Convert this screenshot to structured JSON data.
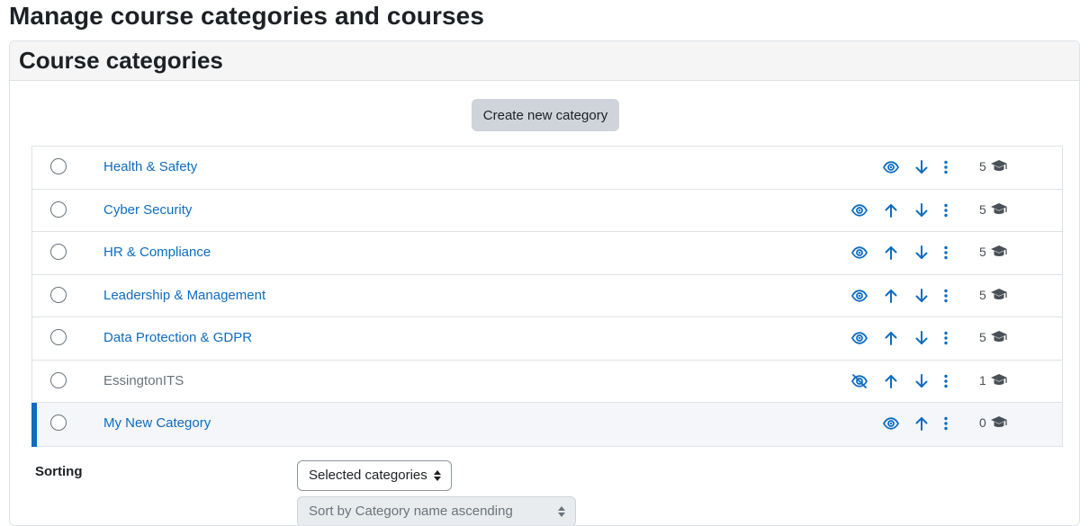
{
  "page": {
    "title": "Manage course categories and courses"
  },
  "card": {
    "header": "Course categories",
    "create_button": "Create new category"
  },
  "categories": [
    {
      "name": "Health & Safety",
      "count": "5",
      "visible": true,
      "up": false,
      "down": true
    },
    {
      "name": "Cyber Security",
      "count": "5",
      "visible": true,
      "up": true,
      "down": true
    },
    {
      "name": "HR & Compliance",
      "count": "5",
      "visible": true,
      "up": true,
      "down": true
    },
    {
      "name": "Leadership & Management",
      "count": "5",
      "visible": true,
      "up": true,
      "down": true
    },
    {
      "name": "Data Protection & GDPR",
      "count": "5",
      "visible": true,
      "up": true,
      "down": true
    },
    {
      "name": "EssingtonITS",
      "count": "1",
      "visible": false,
      "up": true,
      "down": true
    },
    {
      "name": "My New Category",
      "count": "0",
      "visible": true,
      "up": true,
      "down": false,
      "selected": true
    }
  ],
  "sorting": {
    "label": "Sorting",
    "scope_select": "Selected categories",
    "order_select": "Sort by Category name ascending"
  },
  "colors": {
    "link": "#0f6cbf",
    "hidden_text": "#6a737b",
    "button_bg": "#ced4da",
    "selected_bar": "#0f6cbf"
  },
  "icons": {
    "visible": "eye-icon",
    "hidden": "eye-slash-icon",
    "move_up": "arrow-up-icon",
    "move_down": "arrow-down-icon",
    "menu": "kebab-menu-icon",
    "courses": "graduation-cap-icon"
  }
}
